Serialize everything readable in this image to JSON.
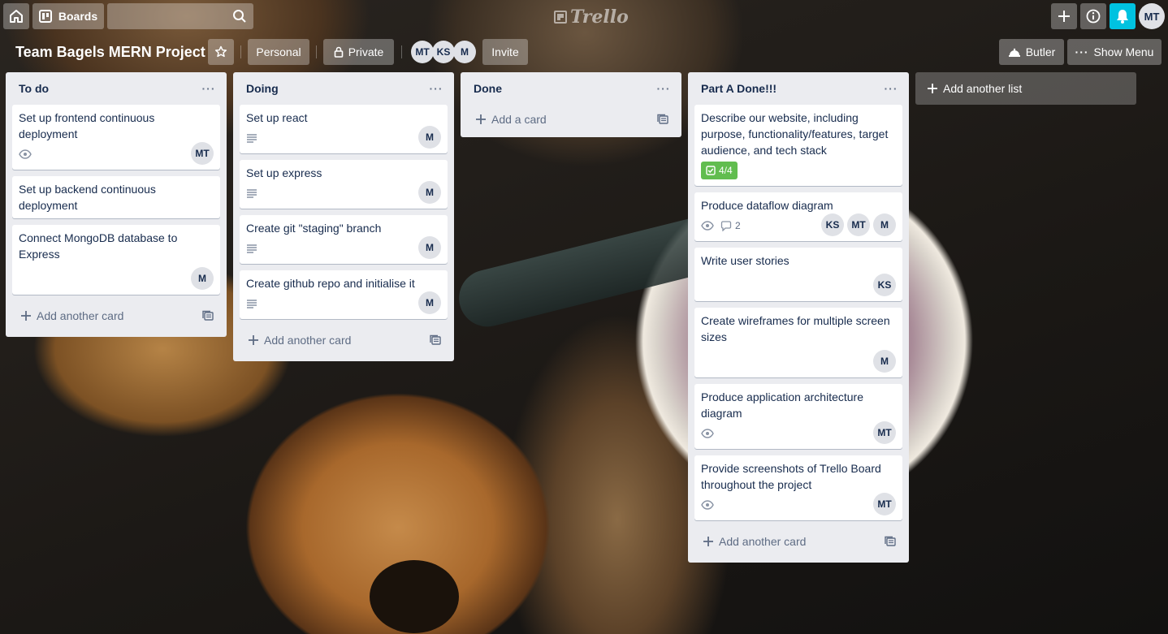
{
  "header": {
    "boards_label": "Boards",
    "logo_text": "Trello",
    "user_initials": "MT"
  },
  "board": {
    "title": "Team Bagels MERN Project",
    "visibility_team": "Personal",
    "visibility": "Private",
    "members": [
      "MT",
      "KS",
      "M"
    ],
    "invite_label": "Invite",
    "butler_label": "Butler",
    "show_menu_label": "Show Menu",
    "add_list_label": "Add another list"
  },
  "lists": [
    {
      "title": "To do",
      "add_label": "Add another card",
      "cards": [
        {
          "title": "Set up frontend continuous deployment",
          "members": [
            "MT"
          ]
        },
        {
          "title": "Set up backend continuous deployment",
          "members": []
        },
        {
          "title": "Connect MongoDB database to Express",
          "members": [
            "M"
          ]
        }
      ]
    },
    {
      "title": "Doing",
      "add_label": "Add another card",
      "cards": [
        {
          "title": "Set up react",
          "members": [
            "M"
          ]
        },
        {
          "title": "Set up express",
          "members": [
            "M"
          ]
        },
        {
          "title": "Create git \"staging\" branch",
          "members": [
            "M"
          ]
        },
        {
          "title": "Create github repo and initialise it",
          "members": [
            "M"
          ]
        }
      ]
    },
    {
      "title": "Done",
      "add_label": "Add a card",
      "cards": []
    },
    {
      "title": "Part A Done!!!",
      "add_label": "Add another card",
      "cards": [
        {
          "title": "Describe our website, including purpose, functionality/features, target audience, and tech stack",
          "checklist": "4/4",
          "members": []
        },
        {
          "title": "Produce dataflow diagram",
          "comments": "2",
          "members": [
            "KS",
            "MT",
            "M"
          ]
        },
        {
          "title": "Write user stories",
          "members": [
            "KS"
          ]
        },
        {
          "title": "Create wireframes for multiple screen sizes",
          "members": [
            "M"
          ]
        },
        {
          "title": "Produce application architecture diagram",
          "members": [
            "MT"
          ]
        },
        {
          "title": "Provide screenshots of Trello Board throughout the project",
          "members": [
            "MT"
          ]
        }
      ]
    }
  ],
  "colors": {
    "list_bg": "#ebecf0",
    "notification_accent": "#00c2e0",
    "checklist_complete": "#61bd4f"
  }
}
